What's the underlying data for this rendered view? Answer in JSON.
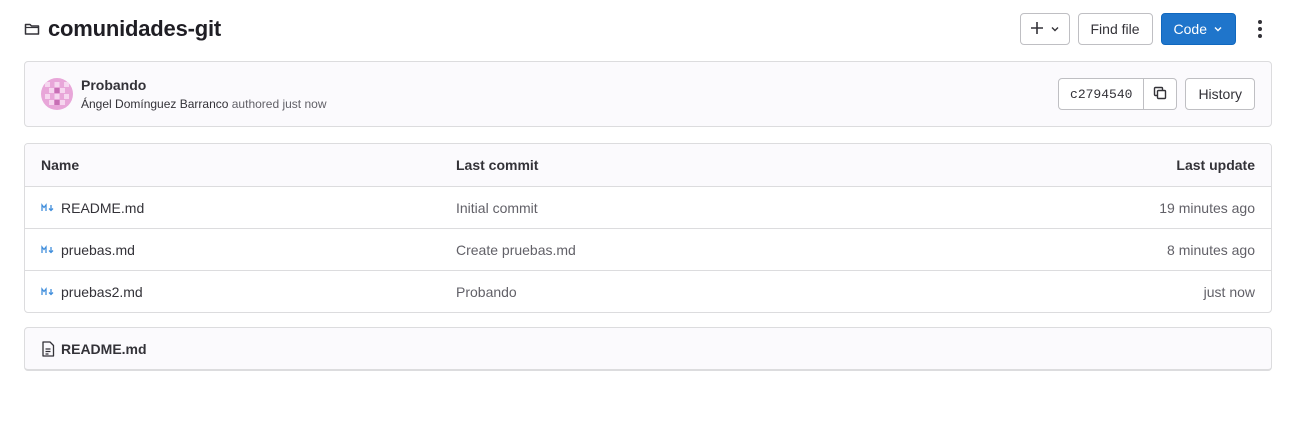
{
  "header": {
    "repo_name": "comunidades-git",
    "find_file_label": "Find file",
    "code_label": "Code"
  },
  "commit": {
    "title": "Probando",
    "author": "Ángel Domínguez Barranco",
    "meta_suffix": " authored just now",
    "sha": "c2794540",
    "history_label": "History"
  },
  "table": {
    "headers": {
      "name": "Name",
      "last_commit": "Last commit",
      "last_update": "Last update"
    },
    "rows": [
      {
        "name": "README.md",
        "commit": "Initial commit",
        "updated": "19 minutes ago"
      },
      {
        "name": "pruebas.md",
        "commit": "Create pruebas.md",
        "updated": "8 minutes ago"
      },
      {
        "name": "pruebas2.md",
        "commit": "Probando",
        "updated": "just now"
      }
    ]
  },
  "readme": {
    "title": "README.md"
  },
  "colors": {
    "primary": "#1f75cb",
    "markdown_icon": "#428fdc",
    "border": "#dcdcde"
  }
}
